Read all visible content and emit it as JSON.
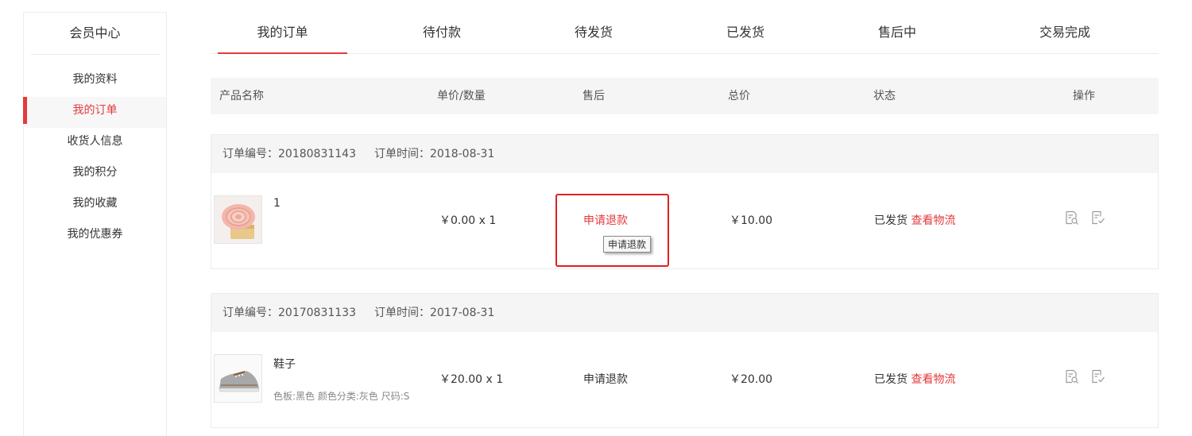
{
  "sidebar": {
    "title": "会员中心",
    "items": [
      {
        "label": "我的资料"
      },
      {
        "label": "我的订单"
      },
      {
        "label": "收货人信息"
      },
      {
        "label": "我的积分"
      },
      {
        "label": "我的收藏"
      },
      {
        "label": "我的优惠券"
      }
    ],
    "active_index": 1
  },
  "tabs": [
    {
      "label": "我的订单"
    },
    {
      "label": "待付款"
    },
    {
      "label": "待发货"
    },
    {
      "label": "已发货"
    },
    {
      "label": "售后中"
    },
    {
      "label": "交易完成"
    }
  ],
  "table_header": {
    "product": "产品名称",
    "price_qty": "单价/数量",
    "after_sale": "售后",
    "total": "总价",
    "status": "状态",
    "action": "操作"
  },
  "orders": [
    {
      "order_no": "订单编号：20180831143",
      "order_time": "订单时间：2018-08-31",
      "product_name": "1",
      "product_spec": "",
      "price_qty": "￥0.00 x 1",
      "refund_label": "申请退款",
      "refund_tooltip": "申请退款",
      "total": "￥10.00",
      "status": "已发货",
      "logistics_link": "查看物流"
    },
    {
      "order_no": "订单编号：20170831133",
      "order_time": "订单时间：2017-08-31",
      "product_name": "鞋子",
      "product_spec": "色板:黑色 颜色分类:灰色 尺码:S",
      "price_qty": "￥20.00 x 1",
      "refund_label": "申请退款",
      "total": "￥20.00",
      "status": "已发货",
      "logistics_link": "查看物流"
    }
  ],
  "colors": {
    "accent": "#e4393c",
    "header_bg": "#f5f5f5",
    "border": "#ececec",
    "highlight": "#e02020"
  },
  "icons": {
    "view_detail": "view-detail-icon",
    "review": "review-icon",
    "product_1": "rose-ribbon-product-image",
    "product_2": "gray-sneaker-product-image"
  }
}
